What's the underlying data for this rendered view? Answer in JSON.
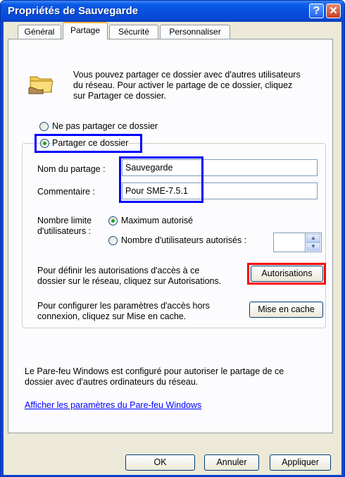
{
  "window": {
    "title": "Propriétés de Sauvegarde",
    "help_glyph": "?",
    "close_glyph": "✕"
  },
  "tabs": [
    {
      "label": "Général"
    },
    {
      "label": "Partage"
    },
    {
      "label": "Sécurité"
    },
    {
      "label": "Personnaliser"
    }
  ],
  "intro": {
    "icon": "shared-folder-icon",
    "text_lines": [
      "Vous pouvez partager ce dossier avec d'autres utilisateurs",
      "du réseau. Pour activer le partage de ce dossier, cliquez",
      "sur Partager ce dossier."
    ]
  },
  "share_options": {
    "no_share": "Ne pas partager ce dossier",
    "share": "Partager ce dossier",
    "selected": "share"
  },
  "fields": {
    "share_name_label": "Nom du partage :",
    "share_name_value": "Sauvegarde",
    "comment_label": "Commentaire :",
    "comment_value": "Pour SME-7.5.1"
  },
  "user_limit": {
    "label_line1": "Nombre limite",
    "label_line2": "d'utilisateurs :",
    "max_allowed": "Maximum autorisé",
    "allowed_count": "Nombre d'utilisateurs autorisés :",
    "selected": "max_allowed"
  },
  "permissions": {
    "text_line1": "Pour définir les autorisations d'accès à ce",
    "text_line2": "dossier sur le réseau, cliquez sur Autorisations.",
    "button": "Autorisations"
  },
  "caching": {
    "text_line1": "Pour configurer les paramètres d'accès hors",
    "text_line2": "connexion, cliquez sur Mise en cache.",
    "button": "Mise en cache"
  },
  "firewall": {
    "text_line1": "Le Pare-feu Windows est configuré pour autoriser le partage de ce",
    "text_line2": "dossier avec d'autres ordinateurs du réseau.",
    "link": "Afficher les paramètres du Pare-feu Windows"
  },
  "footer": {
    "ok": "OK",
    "cancel": "Annuler",
    "apply": "Appliquer"
  },
  "colors": {
    "highlight_blue": "#0000ff",
    "highlight_red": "#ff0000",
    "titlebar": "#0851de"
  }
}
